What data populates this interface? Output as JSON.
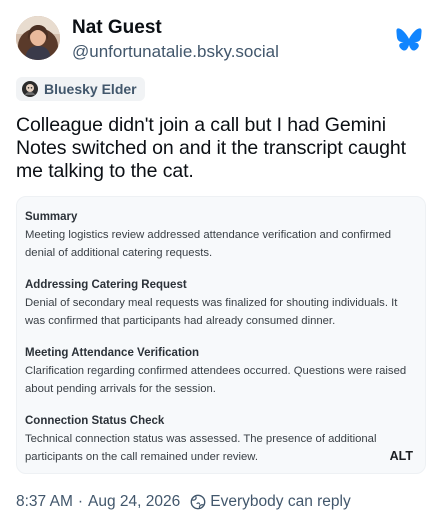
{
  "author": {
    "display_name": "Nat Guest",
    "handle": "@unfortunatalie.bsky.social"
  },
  "icons": {
    "avatar": "avatar-photo",
    "platform_logo": "bluesky-butterfly-icon",
    "badge": "badge-icon",
    "reply_setting": "globe-icon"
  },
  "colors": {
    "brand": "#1185fe",
    "secondary_text": "#42576c"
  },
  "badge": {
    "label": "Bluesky Elder"
  },
  "post": {
    "text": "Colleague didn't join a call but I had Gemini Notes switched on and it the transcript caught me talking to the cat."
  },
  "attachment": {
    "sections": [
      {
        "title": "Summary",
        "body": "Meeting logistics review addressed attendance verification and confirmed denial of additional catering requests."
      },
      {
        "title": "Addressing Catering Request",
        "body": "Denial of secondary meal requests was finalized for shouting individuals. It was confirmed that participants had already consumed dinner."
      },
      {
        "title": "Meeting Attendance Verification",
        "body": "Clarification regarding confirmed attendees occurred. Questions were raised about pending arrivals for the session."
      },
      {
        "title": "Connection Status Check",
        "body": "Technical connection status was assessed. The presence of additional participants on the call remained under review."
      }
    ],
    "alt_label": "ALT"
  },
  "footer": {
    "time": "8:37 AM",
    "separator": "·",
    "date": "Aug 24, 2026",
    "reply_setting": "Everybody can reply"
  }
}
